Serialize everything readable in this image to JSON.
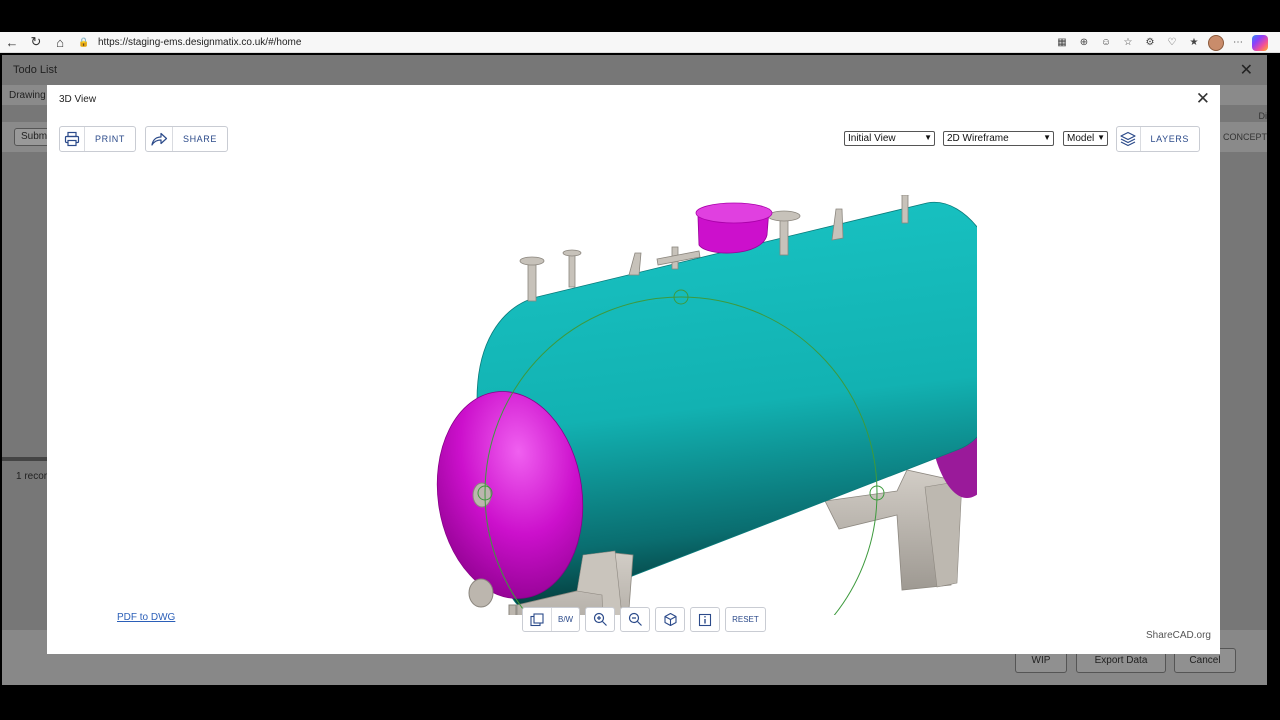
{
  "browser": {
    "url": "https://staging-ems.designmatix.co.uk/#/home",
    "icons": [
      "back-icon",
      "refresh-icon",
      "home-icon",
      "lock-icon",
      "apps-icon",
      "zoom-icon",
      "reader-icon",
      "favorite-icon",
      "extensions-icon",
      "performance-icon",
      "collections-icon",
      "profile-avatar",
      "more-icon",
      "copilot-icon"
    ]
  },
  "app": {
    "title": "Todo List",
    "tab_label": "Drawing",
    "submit_label": "Subm",
    "records_label": "1 recor",
    "right_header": "Di",
    "right_column": "CONCEPT",
    "buttons": {
      "wip": "WIP",
      "export": "Export Data",
      "cancel": "Cancel"
    }
  },
  "modal": {
    "title": "3D View",
    "print_label": "PRINT",
    "share_label": "SHARE",
    "view_select": "Initial View",
    "style_select": "2D Wireframe",
    "space_select": "Model",
    "layers_label": "LAYERS",
    "bw_label": "B/W",
    "reset_label": "RESET",
    "pdf_link": "PDF to DWG",
    "watermark": "ShareCAD.org"
  },
  "colors": {
    "shell": "#12b8b8",
    "heads": "#cc10cc",
    "supports": "#b8b3ab",
    "orbit": "#3d9a3d",
    "accent": "#2b4a8a"
  }
}
